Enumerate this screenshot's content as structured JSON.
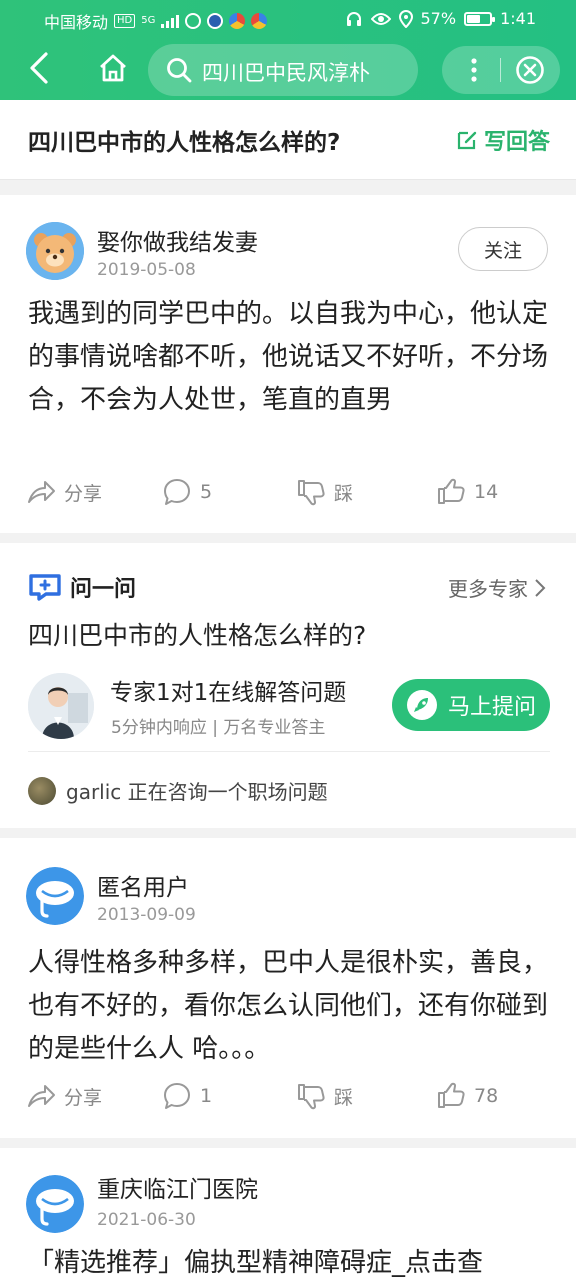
{
  "status": {
    "carrier": "中国移动",
    "hd": "HD",
    "net": "5G",
    "battery": "57%",
    "battery_level": 0.57,
    "time": "1:41"
  },
  "nav": {
    "search_text": "四川巴中民风淳朴"
  },
  "question": {
    "title": "四川巴中市的人性格怎么样的?",
    "write_answer": "写回答"
  },
  "answers": [
    {
      "user": "娶你做我结发妻",
      "date": "2019-05-08",
      "follow": "关注",
      "text": "我遇到的同学巴中的。以自我为中心，他认定的事情说啥都不听，他说话又不好听，不分场合，不会为人处世，笔直的直男",
      "share": "分享",
      "comments": "5",
      "dislike": "踩",
      "likes": "14"
    },
    {
      "user": "匿名用户",
      "date": "2013-09-09",
      "text": "人得性格多种多样，巴中人是很朴实，善良，也有不好的，看你怎么认同他们，还有你碰到的是些什么人 哈。。。",
      "share": "分享",
      "comments": "1",
      "dislike": "踩",
      "likes": "78"
    },
    {
      "user": "重庆临江门医院",
      "date": "2021-06-30",
      "text": "「精选推荐」偏执型精神障碍症_点击查"
    }
  ],
  "ask": {
    "brand": "问一问",
    "more": "更多专家",
    "question": "四川巴中市的人性格怎么样的?",
    "expert_title": "专家1对1在线解答问题",
    "expert_sub": "5分钟内响应 | 万名专业答主",
    "button": "马上提问",
    "live_text": "garlic 正在咨询一个职场问题"
  }
}
